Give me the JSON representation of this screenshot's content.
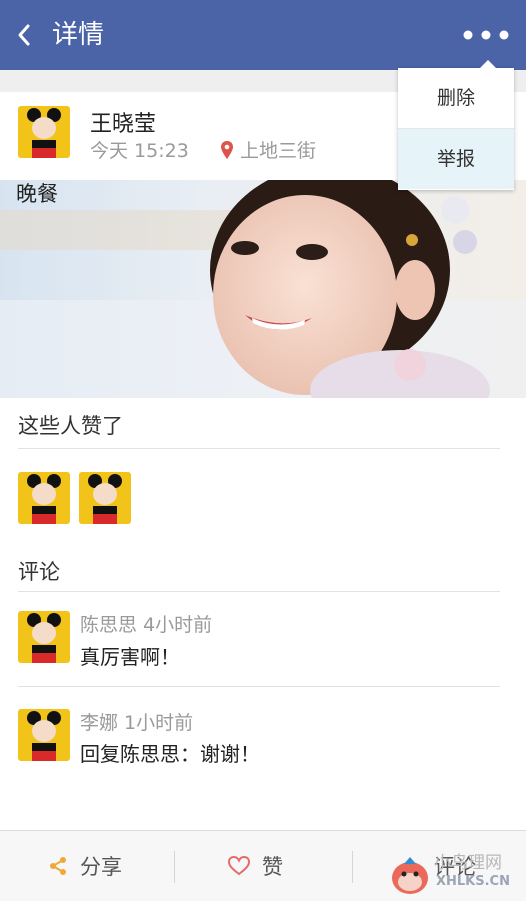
{
  "header": {
    "title": "详情",
    "back_icon": "chevron-left-icon",
    "more_icon": "more-dots-icon",
    "bg_color": "#4b64a8"
  },
  "menu": {
    "items": [
      {
        "label": "删除"
      },
      {
        "label": "举报"
      }
    ]
  },
  "post": {
    "author": "王晓莹",
    "time": "今天 15:23",
    "location": "上地三街",
    "text": "晚餐"
  },
  "likes": {
    "title": "这些人赞了"
  },
  "comments": {
    "title": "评论",
    "items": [
      {
        "name": "陈思思",
        "time": "4小时前",
        "name_time": "陈思思 4小时前",
        "text": "真厉害啊！"
      },
      {
        "name": "李娜",
        "time": "1小时前",
        "name_time": "李娜 1小时前",
        "text": "回复陈思思：谢谢！"
      }
    ]
  },
  "bottom_bar": {
    "share": "分享",
    "like": "赞",
    "comment": "评论"
  },
  "watermark": {
    "text": "小鸟理网",
    "url": "XHLKS.CN"
  }
}
